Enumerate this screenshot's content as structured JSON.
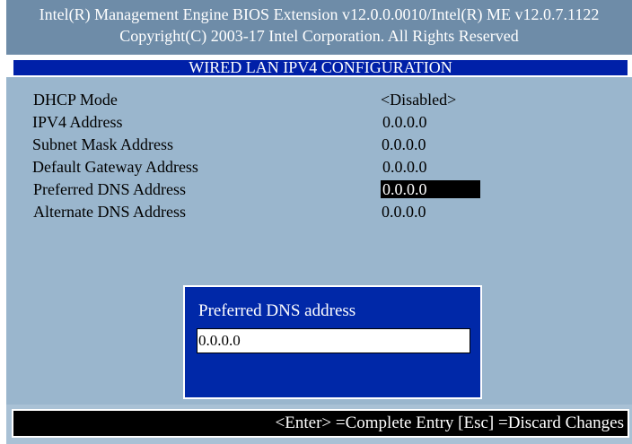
{
  "header": {
    "line1": "Intel(R) Management Engine BIOS Extension v12.0.0.0010/Intel(R) ME v12.0.7.1122",
    "line2": "Copyright(C) 2003-17 Intel Corporation. All Rights Reserved"
  },
  "section_title": "WIRED LAN IPV4 CONFIGURATION",
  "settings": [
    {
      "label": "DHCP Mode",
      "value": "<Disabled>"
    },
    {
      "label": "IPV4 Address",
      "value": "0.0.0.0"
    },
    {
      "label": "Subnet Mask Address",
      "value": "0.0.0.0"
    },
    {
      "label": "Default Gateway Address",
      "value": "0.0.0.0"
    },
    {
      "label": "Preferred DNS Address",
      "value": "0.0.0.0",
      "selected": true
    },
    {
      "label": "Alternate DNS Address",
      "value": "0.0.0.0"
    }
  ],
  "dialog": {
    "title": "Preferred DNS address",
    "input_value": "0.0.0.0"
  },
  "footer": {
    "help": "<Enter> =Complete Entry  [Esc] =Discard Changes"
  },
  "colors": {
    "header_bg": "#6e8ca8",
    "title_bg": "#0020a8",
    "main_bg": "#9ab6cd",
    "dialog_bg": "#0028a8",
    "footer_bg": "#000000"
  }
}
